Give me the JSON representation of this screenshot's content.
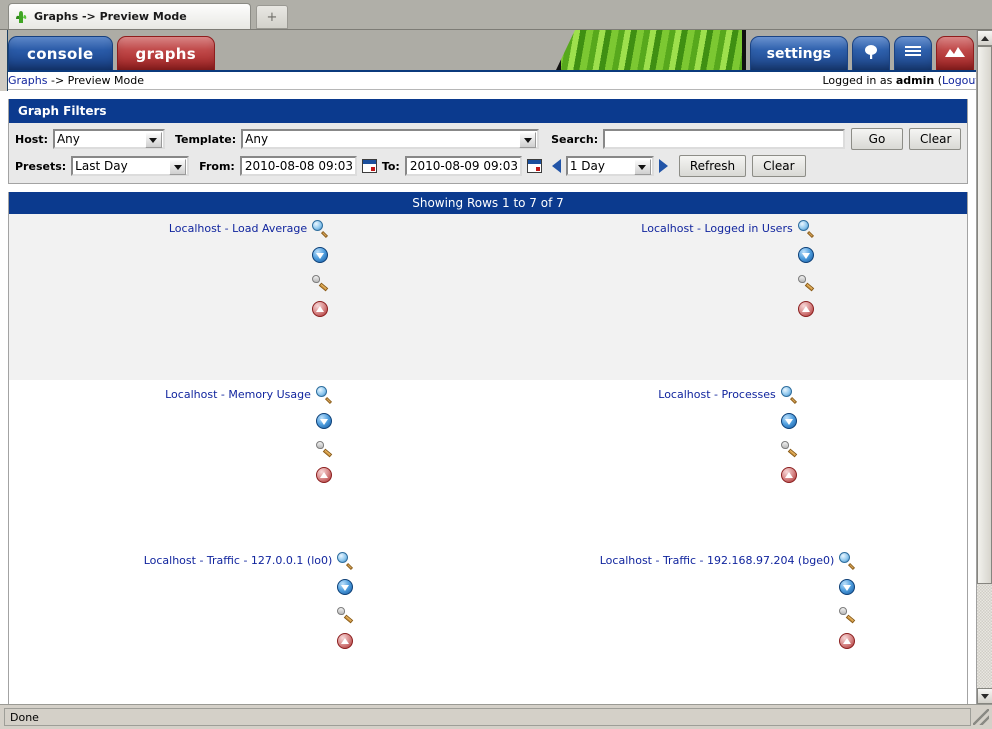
{
  "browser": {
    "tab_title": "Graphs -> Preview Mode",
    "newtab_label": "+",
    "status_text": "Done"
  },
  "header": {
    "tabs": [
      {
        "label": "console",
        "name": "console-tab",
        "color": "#2a5ba8"
      },
      {
        "label": "graphs",
        "name": "graphs-tab",
        "color": "#c04a4a"
      }
    ],
    "right_buttons": [
      {
        "label": "settings",
        "name": "settings-button"
      },
      {
        "label": "",
        "name": "tree-view-icon"
      },
      {
        "label": "",
        "name": "list-view-icon"
      },
      {
        "label": "",
        "name": "preview-view-icon"
      }
    ]
  },
  "breadcrumb": {
    "link": "Graphs",
    "separator": " -> ",
    "current": "Preview Mode",
    "login_prefix": "Logged in as ",
    "login_user": "admin",
    "logout_open": " (",
    "logout_label": "Logout",
    "logout_close": ")"
  },
  "filters": {
    "title": "Graph Filters",
    "host_label": "Host:",
    "host_value": "Any",
    "template_label": "Template:",
    "template_value": "Any",
    "search_label": "Search:",
    "search_value": "",
    "search_placeholder": "",
    "go_label": "Go",
    "clear_label": "Clear",
    "presets_label": "Presets:",
    "presets_value": "Last Day",
    "from_label": "From:",
    "from_value": "2010-08-08 09:03",
    "to_label": "To:",
    "to_value": "2010-08-09 09:03",
    "interval_value": "1 Day",
    "refresh_label": "Refresh",
    "clear2_label": "Clear"
  },
  "results": {
    "showing_rows": "Showing Rows 1 to 7 of 7",
    "graph_actions": [
      {
        "name": "zoom-graph-icon",
        "title": "Zoom Graph"
      },
      {
        "name": "download-graph-icon",
        "title": "Export Graph"
      },
      {
        "name": "graph-properties-icon",
        "title": "Graph Properties"
      },
      {
        "name": "csv-export-icon",
        "title": "CSV Export"
      }
    ],
    "rows": [
      {
        "shade": true,
        "cells": [
          {
            "title": "Localhost - Load Average"
          },
          {
            "title": "Localhost - Logged in Users"
          }
        ]
      },
      {
        "shade": false,
        "cells": [
          {
            "title": "Localhost - Memory Usage"
          },
          {
            "title": "Localhost - Processes"
          }
        ]
      },
      {
        "shade": false,
        "cells": [
          {
            "title": "Localhost - Traffic - 127.0.0.1 (lo0)"
          },
          {
            "title": "Localhost - Traffic - 192.168.97.204 (bge0)"
          }
        ]
      }
    ]
  },
  "colors": {
    "panel_header": "#0b3a8e",
    "link": "#11259e",
    "chrome": "#adaca5",
    "accent_red": "#c04a4a"
  }
}
